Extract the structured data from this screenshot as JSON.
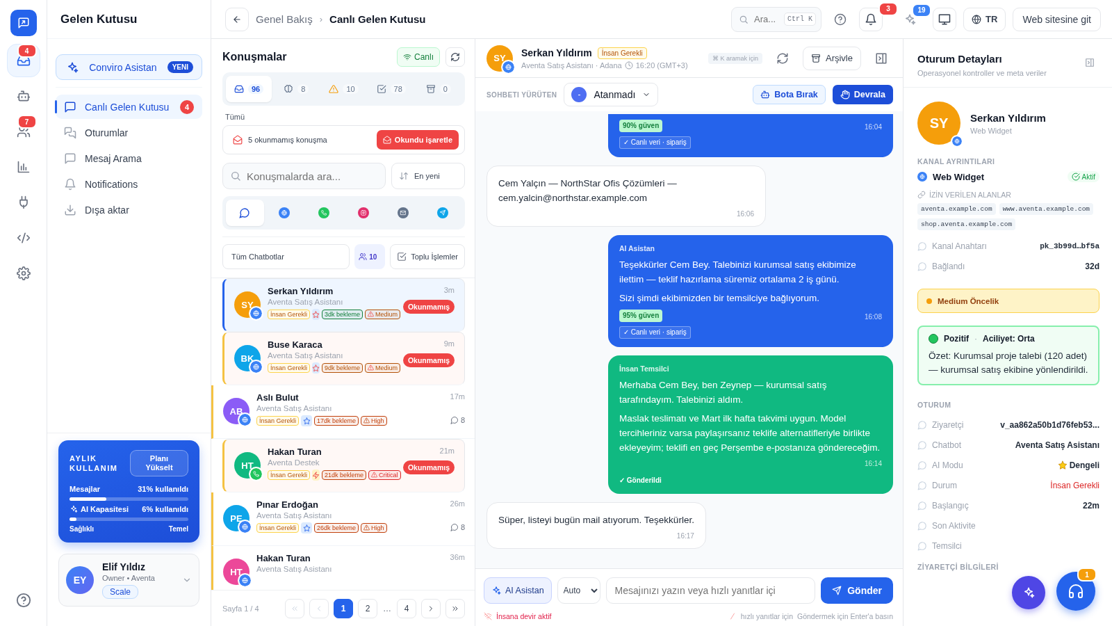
{
  "rail": {
    "items": [
      {
        "kind": "inbox",
        "selected": true,
        "badge": "4"
      },
      {
        "kind": "bot",
        "selected": false
      },
      {
        "kind": "users",
        "selected": false,
        "badge": "7"
      },
      {
        "kind": "chart",
        "selected": false
      },
      {
        "kind": "plug",
        "selected": false
      },
      {
        "kind": "code",
        "selected": false
      },
      {
        "kind": "gear",
        "selected": false
      }
    ]
  },
  "nav": {
    "title": "Gelen Kutusu",
    "assistant": {
      "label": "Conviro Asistan",
      "badge": "YENI"
    },
    "items": [
      {
        "kind": "chat",
        "label": "Canlı Gelen Kutusu",
        "selected": true,
        "badge": "4"
      },
      {
        "kind": "chats",
        "label": "Oturumlar",
        "selected": false
      },
      {
        "kind": "chat",
        "label": "Mesaj Arama",
        "selected": false
      },
      {
        "kind": "bell",
        "label": "Notifications",
        "selected": false
      },
      {
        "kind": "download",
        "label": "Dışa aktar",
        "selected": false
      }
    ],
    "usage": {
      "title": "AYLIK KULLANIM",
      "upgrade": "Planı Yükselt",
      "meters": [
        {
          "kind": "plain",
          "label": "Mesajlar",
          "reading": "31% kullanıldı",
          "level": 0.31
        },
        {
          "kind": "ai",
          "label": "AI Kapasitesi",
          "reading": "6% kullanıldı",
          "level": 0.06
        }
      ],
      "notes": [
        "Sağlıklı",
        "Temel"
      ]
    },
    "user": {
      "initials": "EY",
      "name": "Elif Yıldız",
      "role": "Owner • Aventa",
      "plan": "Scale"
    }
  },
  "topbar": {
    "breadcrumb": [
      {
        "label": "Genel Bakış",
        "current": false
      },
      {
        "label": "Canlı Gelen Kutusu",
        "current": true
      }
    ],
    "separator": "›",
    "search": {
      "placeholder": "Ara...",
      "shortcut": "Ctrl K"
    },
    "notifications": "3",
    "assistant_count": "19",
    "language": "TR",
    "website": "Web sitesine git"
  },
  "conversations": {
    "title": "Konuşmalar",
    "live": "Canlı",
    "folders": [
      {
        "kind": "inbox",
        "count": "96",
        "selected": true
      },
      {
        "kind": "brain",
        "count": "8",
        "selected": false
      },
      {
        "kind": "alert",
        "count": "10",
        "selected": false
      },
      {
        "kind": "done",
        "count": "78",
        "selected": false
      },
      {
        "kind": "archive",
        "count": "0",
        "selected": false
      }
    ],
    "folder_label": "Tümü",
    "unread": {
      "text": "5 okunmamış konuşma",
      "action": "Okundu işaretle"
    },
    "search": {
      "placeholder": "Konuşmalarda ara..."
    },
    "sort": "En yeni",
    "channels": [
      {
        "kind": "all",
        "selected": true
      },
      {
        "kind": "web",
        "selected": false
      },
      {
        "kind": "whatsapp",
        "selected": false
      },
      {
        "kind": "instagram",
        "selected": false
      },
      {
        "kind": "email",
        "selected": false
      },
      {
        "kind": "telegram",
        "selected": false
      }
    ],
    "bot_filter": "Tüm Chatbotlar",
    "agents": "10",
    "bulk": "Toplu İşlemler",
    "items": [
      {
        "initials": "SY",
        "color": "#f59e0b",
        "channel": {
          "kind": "web"
        },
        "name": "Serkan Yıldırım",
        "bot": "Aventa Satış Asistanı",
        "time": "3m",
        "tag": "İnsan Gerekli",
        "mode": {
          "kind": "star"
        },
        "wait": {
          "text": "3dk bekleme",
          "color": "#15803d"
        },
        "priority": {
          "text": "Medium",
          "color": "#b45309"
        },
        "badge": "Okunmamış",
        "unread": true,
        "selected": true
      },
      {
        "initials": "BK",
        "color": "#0ea5e9",
        "channel": {
          "kind": "web"
        },
        "name": "Buse Karaca",
        "bot": "Aventa Satış Asistanı",
        "time": "9m",
        "tag": "İnsan Gerekli",
        "mode": {
          "kind": "star"
        },
        "wait": {
          "text": "9dk bekleme",
          "color": "#b45309"
        },
        "priority": {
          "text": "Medium",
          "color": "#b45309"
        },
        "badge": "Okunmamış",
        "unread": true,
        "selected": false
      },
      {
        "initials": "AB",
        "color": "#8b5cf6",
        "channel": {
          "kind": "web"
        },
        "name": "Aslı Bulut",
        "bot": "Aventa Satış Asistanı",
        "time": "17m",
        "tag": "İnsan Gerekli",
        "mode": {
          "kind": "star"
        },
        "wait": {
          "text": "17dk bekleme",
          "color": "#c2410c"
        },
        "priority": {
          "text": "High",
          "color": "#c2410c"
        },
        "comments": "8",
        "unread": false,
        "selected": false
      },
      {
        "initials": "HT",
        "color": "#10b981",
        "channel": {
          "kind": "whatsapp"
        },
        "name": "Hakan Turan",
        "bot": "Aventa Destek",
        "time": "21m",
        "tag": "İnsan Gerekli",
        "mode": {
          "kind": "bolt"
        },
        "wait": {
          "text": "21dk bekleme",
          "color": "#c2410c"
        },
        "priority": {
          "text": "Critical",
          "color": "#dc2626"
        },
        "badge": "Okunmamış",
        "unread": true,
        "selected": false
      },
      {
        "initials": "PE",
        "color": "#0ea5e9",
        "channel": {
          "kind": "web"
        },
        "name": "Pınar Erdoğan",
        "bot": "Aventa Satış Asistanı",
        "time": "26m",
        "tag": "İnsan Gerekli",
        "mode": {
          "kind": "star"
        },
        "wait": {
          "text": "26dk bekleme",
          "color": "#c2410c"
        },
        "priority": {
          "text": "High",
          "color": "#c2410c"
        },
        "comments": "8",
        "unread": false,
        "selected": false
      },
      {
        "initials": "HT",
        "color": "#ec4899",
        "channel": {
          "kind": "web"
        },
        "name": "Hakan Turan",
        "bot": "Aventa Satış Asistanı",
        "time": "36m",
        "unread": false,
        "selected": false
      }
    ],
    "pagination": {
      "label": "Sayfa 1 / 4",
      "pages": [
        {
          "kind": "page",
          "label": "1",
          "selected": true
        },
        {
          "kind": "page",
          "label": "2",
          "selected": false
        },
        {
          "kind": "gap",
          "label": "…"
        },
        {
          "kind": "page",
          "label": "4",
          "selected": false
        }
      ]
    }
  },
  "chat": {
    "contact": {
      "initials": "SY",
      "color": "#f59e0b",
      "channel": {
        "kind": "web"
      },
      "name": "Serkan Yıldırım",
      "tag": "İnsan Gerekli",
      "subtitle": "Aventa Satış Asistanı · Adana",
      "local_time": "16:20 (GMT+3)"
    },
    "shortcut": "⌘ K aramak için",
    "archive": "Arşivle",
    "owner_label": "SOHBETI YÜRÜTEN",
    "owner": {
      "initials": "-",
      "name": "Atanmadı"
    },
    "release": "Bota Bırak",
    "takeover": "Devrala",
    "messages": [
      {
        "kind": "bot",
        "confidence": "90% güven",
        "time": "16:04",
        "source": "✓ Canlı veri · sipariş"
      },
      {
        "kind": "customer",
        "paragraphs": [
          "Cem Yalçın — NorthStar Ofis Çözümleri — cem.yalcin@northstar.example.com"
        ],
        "time": "16:06"
      },
      {
        "kind": "bot",
        "sender": "AI Asistan",
        "paragraphs": [
          "Teşekkürler Cem Bey. Talebinizi kurumsal satış ekibimize ilettim — teklif hazırlama süremiz ortalama 2 iş günü.",
          "Sizi şimdi ekibimizden bir temsilciye bağlıyorum."
        ],
        "confidence": "95% güven",
        "time": "16:08",
        "source": "✓ Canlı veri · sipariş"
      },
      {
        "kind": "agent",
        "sender": "İnsan Temsilci",
        "paragraphs": [
          "Merhaba Cem Bey, ben Zeynep — kurumsal satış tarafındayım. Talebinizi aldım.",
          "Maslak teslimatı ve Mart ilk hafta takvimi uygun. Model tercihleriniz varsa paylaşırsanız teklife alternatifleriyle birlikte ekleyeyim; teklifi en geç Perşembe e-postanıza göndereceğim."
        ],
        "time": "16:14",
        "status": "✓ Gönderildi"
      },
      {
        "kind": "customer",
        "paragraphs": [
          "Süper, listeyi bugün mail atıyorum. Teşekkürler."
        ],
        "time": "16:17"
      }
    ],
    "composer": {
      "assistant": "AI Asistan",
      "mode": "Auto",
      "placeholder": "Mesajınızı yazın veya hızlı yanıtlar içi",
      "send": "Gönder"
    },
    "footer": {
      "handoff": "İnsana devir aktif",
      "hint": "hızlı yanıtlar için",
      "enter": "Göndermek için Enter'a basın"
    }
  },
  "details": {
    "title": "Oturum Detayları",
    "subtitle": "Operasyonel kontroller ve meta veriler",
    "profile": {
      "initials": "SY",
      "color": "#f59e0b",
      "channel_icon": {
        "kind": "web"
      },
      "name": "Serkan Yıldırım",
      "channel": "Web Widget"
    },
    "channel_section": "KANAL AYRINTILARI",
    "channel": {
      "kind": "web",
      "name": "Web Widget",
      "status": "Aktif"
    },
    "domains_label": "İZİN VERİLEN ALANLAR",
    "domains": [
      "aventa.example.com",
      "www.aventa.example.com",
      "shop.aventa.example.com"
    ],
    "channel_rows": [
      {
        "label": "Kanal Anahtarı",
        "value": "pk_3b99d…bf5a",
        "kind": "mono"
      },
      {
        "label": "Bağlandı",
        "value": "32d",
        "kind": "plain"
      }
    ],
    "priority": "Medium Öncelik",
    "sentiment": {
      "label": "Pozitif",
      "separator": "·",
      "urgency": "Aciliyet: Orta",
      "summary": "Özet: Kurumsal proje talebi (120 adet) — kurumsal satış ekibine yönlendirildi."
    },
    "session_section": "OTURUM",
    "session_rows": [
      {
        "label": "Ziyaretçi",
        "value": "v_aa862a50b1d76feb53...",
        "kind": "plain"
      },
      {
        "label": "Chatbot",
        "value": "Aventa Satış Asistanı",
        "kind": "plain"
      },
      {
        "label": "AI Modu",
        "value": "Dengeli",
        "kind": "star"
      },
      {
        "label": "Durum",
        "value": "İnsan Gerekli",
        "kind": "danger"
      },
      {
        "label": "Başlangıç",
        "value": "22m",
        "kind": "plain"
      },
      {
        "label": "Son Aktivite"
      },
      {
        "label": "Temsilci"
      }
    ],
    "visitor_section": "ZİYARETÇİ BİLGİLERİ"
  },
  "support": {
    "badge": "1"
  }
}
